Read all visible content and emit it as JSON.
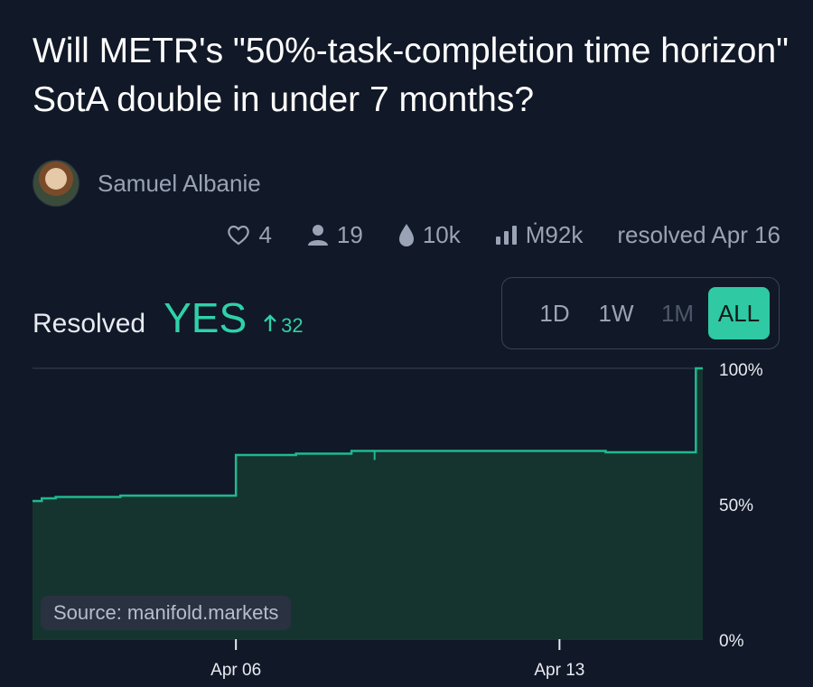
{
  "question": {
    "title": "Will METR's \"50%-task-completion time horizon\" SotA double in under 7 months?"
  },
  "author": {
    "name": "Samuel Albanie"
  },
  "stats": {
    "likes": "4",
    "traders": "19",
    "liquidity": "10k",
    "volume": "Ṁ92k",
    "resolution": "resolved Apr 16"
  },
  "resolution": {
    "label": "Resolved",
    "value": "YES",
    "delta": "32"
  },
  "range_buttons": [
    "1D",
    "1W",
    "1M",
    "ALL"
  ],
  "range_selected": "ALL",
  "source_label": "Source: manifold.markets",
  "colors": {
    "background": "#111827",
    "accent": "#2fd1a8",
    "area_fill": "#16342f",
    "line": "#1fb98f",
    "muted_text": "#9aa3b5"
  },
  "chart_data": {
    "type": "area",
    "title": "",
    "xlabel": "",
    "ylabel": "",
    "x_ticks": [
      "Apr 06",
      "Apr 13"
    ],
    "x_tick_days": [
      6,
      13
    ],
    "y_ticks": [
      "100%",
      "50%",
      "0%"
    ],
    "ylim": [
      0,
      100
    ],
    "xlim": [
      1.6,
      16.1
    ],
    "gridlines": true,
    "series": [
      {
        "points": [
          [
            1.6,
            51
          ],
          [
            1.8,
            52
          ],
          [
            2.1,
            52.5
          ],
          [
            3.5,
            53
          ],
          [
            5.9,
            53
          ],
          [
            6.0,
            68
          ],
          [
            7.0,
            68
          ],
          [
            7.3,
            68.5
          ],
          [
            8.5,
            69.5
          ],
          [
            9.5,
            69.5
          ],
          [
            11.5,
            69.5
          ],
          [
            12.8,
            69.5
          ],
          [
            14.0,
            69
          ],
          [
            15.9,
            69
          ],
          [
            15.95,
            100
          ],
          [
            16.1,
            100
          ]
        ]
      }
    ]
  }
}
